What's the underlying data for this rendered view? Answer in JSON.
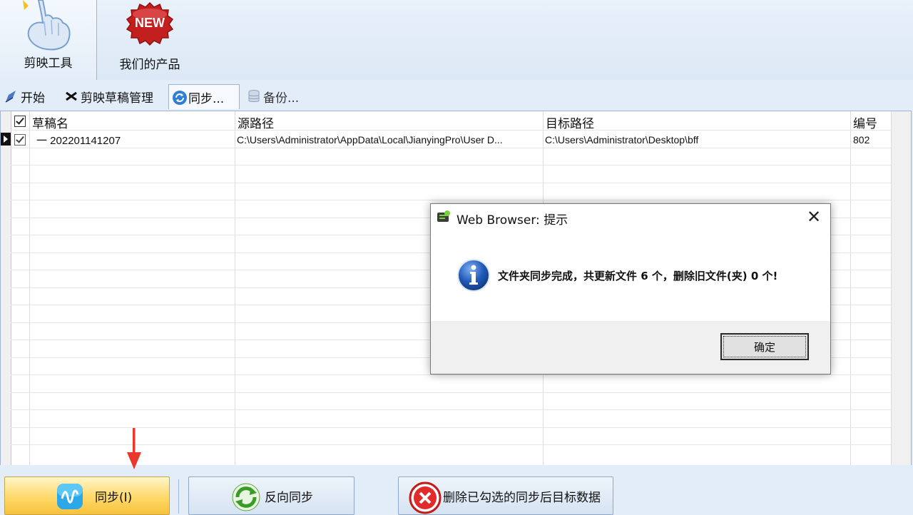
{
  "ribbon": {
    "tools_label": "剪映工具",
    "products_label": "我们的产品",
    "new_badge": "NEW"
  },
  "tabs": [
    {
      "label": "开始",
      "icon": "pen-icon"
    },
    {
      "label": "剪映草稿管理",
      "icon": "capcut-icon"
    },
    {
      "label": "同步...",
      "icon": "sync-icon"
    },
    {
      "label": "备份...",
      "icon": "database-icon"
    }
  ],
  "table": {
    "columns": [
      "草稿名",
      "源路径",
      "目标路径",
      "编号"
    ],
    "rows": [
      {
        "name": "一 202201141207",
        "source": "C:\\Users\\Administrator\\AppData\\Local\\JianyingPro\\User D...",
        "target": "C:\\Users\\Administrator\\Desktop\\bff",
        "id": "802"
      }
    ]
  },
  "toolbar": {
    "sync_label": "同步(I)",
    "reverse_sync_label": "反向同步",
    "delete_label": "删除已勾选的同步后目标数据"
  },
  "dialog": {
    "title": "Web Browser: 提示",
    "message": "文件夹同步完成，共更新文件 6 个，删除旧文件(夹) 0 个!",
    "ok_label": "确定"
  },
  "colors": {
    "accent": "#ffd968",
    "background": "#e3edf8",
    "info_blue": "#1f4fa8",
    "arrow_red": "#e8392c"
  }
}
